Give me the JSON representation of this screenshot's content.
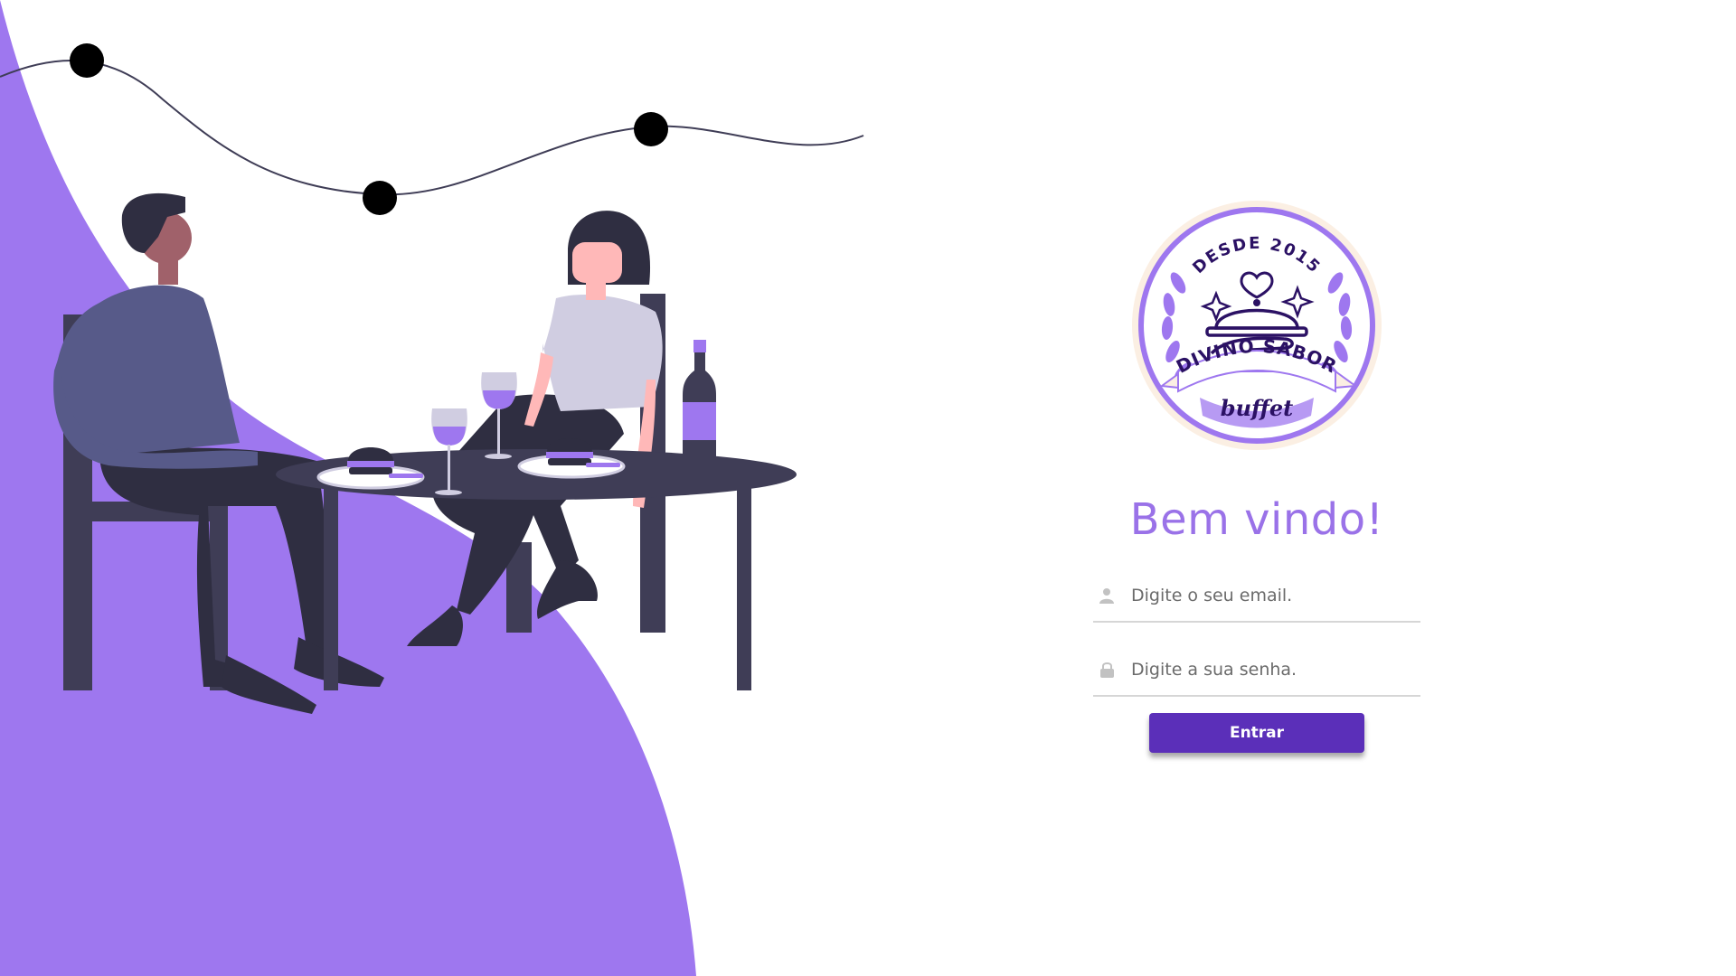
{
  "brand": {
    "badge_top_text": "DESDE 2015",
    "badge_name": "DIVINO SABOR",
    "badge_sub": "buffet"
  },
  "login": {
    "welcome": "Bem vindo!",
    "email_placeholder": "Digite o seu email.",
    "password_placeholder": "Digite a sua senha.",
    "submit_label": "Entrar"
  },
  "colors": {
    "accent": "#9a72e8",
    "button": "#5b2fb9",
    "illustration_bg": "#9e77ef",
    "dark": "#3f3d56"
  },
  "icons": {
    "email": "user-icon",
    "password": "lock-icon"
  }
}
